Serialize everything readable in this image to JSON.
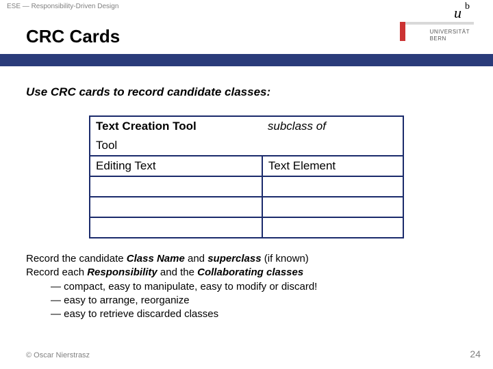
{
  "breadcrumb": "ESE — Responsibility-Driven Design",
  "logo": {
    "u": "u",
    "b": "b",
    "line1": "UNIVERSITÄT",
    "line2": "BERN"
  },
  "title": "CRC Cards",
  "intro": "Use CRC cards to record candidate classes:",
  "card": {
    "class_name": "Text Creation Tool",
    "subclass_label": "subclass of",
    "superclass": "Tool",
    "responsibility1": "Editing Text",
    "collaborator1": "Text Element"
  },
  "notes": {
    "l1_a": "Record the candidate ",
    "l1_b": "Class Name",
    "l1_c": " and ",
    "l1_d": "superclass",
    "l1_e": " (if known)",
    "l2_a": "Record each ",
    "l2_b": "Responsibility",
    "l2_c": " and the ",
    "l2_d": "Collaborating classes",
    "l3": "— compact, easy to manipulate, easy to modify or discard!",
    "l4": "— easy to arrange, reorganize",
    "l5": "— easy to retrieve discarded classes"
  },
  "footer": {
    "copyright": "© Oscar Nierstrasz",
    "page": "24"
  }
}
